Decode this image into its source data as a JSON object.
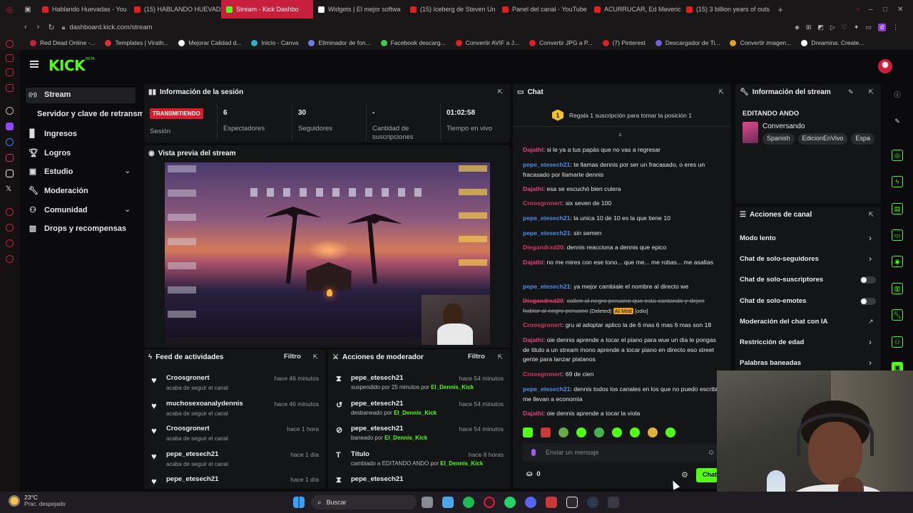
{
  "browser": {
    "tabs": [
      {
        "title": "Hablando Huevadas - You",
        "color": "#e02020"
      },
      {
        "title": "(15) HABLANDO HUEVADA",
        "color": "#e02020"
      },
      {
        "title": "Stream - Kick Dashbo",
        "color": "#53fc18"
      },
      {
        "title": "Widgets | El mejor softwa",
        "color": "#ffffff"
      },
      {
        "title": "(15) Iceberg de Steven Un",
        "color": "#e02020"
      },
      {
        "title": "Panel del canal - YouTube",
        "color": "#e02020"
      },
      {
        "title": "ACURRUCAR, Ed Maverick",
        "color": "#e02020"
      },
      {
        "title": "(15) 3 billion years of outs",
        "color": "#e02020"
      }
    ],
    "url": "dashboard.kick.com/stream",
    "bookmarks": [
      {
        "label": "Red Dead Online -...",
        "color": "#c81f3c"
      },
      {
        "label": "Templates | Virath...",
        "color": "#e03030"
      },
      {
        "label": "Mejorar Calidad d...",
        "color": "#ffffff"
      },
      {
        "label": "Inicio - Canva",
        "color": "#2bb0d0"
      },
      {
        "label": "Eliminador de fon...",
        "color": "#6a7ef0"
      },
      {
        "label": "Facebook descarg...",
        "color": "#3cd050"
      },
      {
        "label": "Convertir AVIF a J...",
        "color": "#e02020"
      },
      {
        "label": "Convertir JPG a P...",
        "color": "#e02020"
      },
      {
        "label": "(7) Pinterest",
        "color": "#e02020"
      },
      {
        "label": "Descargador de Ti...",
        "color": "#7060e0"
      },
      {
        "label": "Convertir imagen...",
        "color": "#e0a020"
      },
      {
        "label": "Dreamina: Create...",
        "color": "#ffffff"
      }
    ]
  },
  "kick": {
    "logo": "KICK",
    "logo_badge": "BETA",
    "sidebar": [
      {
        "label": "Stream",
        "icon": "broadcast-icon",
        "active": true
      },
      {
        "label": "Servidor y clave de retransm",
        "icon": "",
        "sub": true
      },
      {
        "label": "Ingresos",
        "icon": "chart-icon"
      },
      {
        "label": "Logros",
        "icon": "trophy-icon"
      },
      {
        "label": "Estudio",
        "icon": "studio-icon",
        "chevron": true
      },
      {
        "label": "Moderación",
        "icon": "wrench-icon"
      },
      {
        "label": "Comunidad",
        "icon": "community-icon",
        "chevron": true
      },
      {
        "label": "Drops y recompensas",
        "icon": "gift-icon"
      }
    ],
    "session": {
      "title": "Información de la sesión",
      "status_badge": "TRANSMITIENDO",
      "status_label": "Sesión",
      "stats": [
        {
          "value": "6",
          "label": "Espectadores"
        },
        {
          "value": "30",
          "label": "Seguidores"
        },
        {
          "value": "-",
          "label": "Cantidad de suscripciones"
        },
        {
          "value": "01:02:58",
          "label": "Tiempo en vivo"
        }
      ]
    },
    "preview": {
      "title": "Vista previa del stream"
    },
    "feed": {
      "title": "Feed de actividades",
      "filter": "Filtro",
      "items": [
        {
          "name": "Croosgronert",
          "sub": "acaba de seguir el canal",
          "time": "hace 46 minutos"
        },
        {
          "name": "muchosexoanalydennis",
          "sub": "acaba de seguir el canal",
          "time": "hace 46 minutos"
        },
        {
          "name": "Croosgronert",
          "sub": "acaba de seguir el canal",
          "time": "hace 1 hora"
        },
        {
          "name": "pepe_etesech21",
          "sub": "acaba de seguir el canal",
          "time": "hace 1 día"
        },
        {
          "name": "pepe_etesech21",
          "sub": "",
          "time": "hace 1 día"
        }
      ]
    },
    "mod": {
      "title": "Acciones de moderador",
      "filter": "Filtro",
      "items": [
        {
          "name": "pepe_etesech21",
          "sub": "suspendido por 25 minutos por",
          "by": "El_Dennis_Kick",
          "time": "hace 54 minutos",
          "icon": "hourglass-icon"
        },
        {
          "name": "pepe_etesech21",
          "sub": "desbaneado por",
          "by": "El_Dennis_Kick",
          "time": "hace 54 minutos",
          "icon": "undo-icon"
        },
        {
          "name": "pepe_etesech21",
          "sub": "baneado por",
          "by": "El_Dennis_Kick",
          "time": "hace 54 minutos",
          "icon": "ban-icon"
        },
        {
          "name": "Título",
          "sub": "cambiado a EDITANDO ANDO por",
          "by": "El_Dennis_Kick",
          "time": "hace 8 horas",
          "icon": "title-icon"
        },
        {
          "name": "pepe_etesech21",
          "sub": "",
          "by": "",
          "time": "",
          "icon": "hourglass-icon"
        }
      ]
    },
    "chat": {
      "title": "Chat",
      "sub_banner": "Regala 1 suscripción para tomar la posición 1",
      "input_placeholder": "Enviar un mensaje",
      "points": "0",
      "send": "Chat",
      "messages": [
        {
          "user": "Dajathi",
          "color": "pink",
          "text": "si le ya a tus papás que no vas a regresar"
        },
        {
          "user": "pepe_etesech21",
          "color": "blue",
          "text": "te llamas dennis por ser un fracasado, o eres un fracasado por llamarte dennis"
        },
        {
          "user": "Dajathi",
          "color": "pink",
          "text": "esa se escuchó bien culera"
        },
        {
          "user": "Croosgronert",
          "color": "red",
          "text": "six seven de 100"
        },
        {
          "user": "pepe_etesech21",
          "color": "blue",
          "text": "la unica 10 de 10 es la que tiene 10"
        },
        {
          "user": "pepe_etesech21",
          "color": "blue",
          "text": "sin semen"
        },
        {
          "user": "Diegandrxd20",
          "color": "red",
          "text": "dennis reacciona a dennis que epico"
        },
        {
          "user": "Dajathi",
          "color": "pink",
          "text": "no me mires con ese tono... que me... me robas... me asaltas"
        },
        {
          "user": "pepe_etesech21",
          "color": "blue",
          "text": "ya mejor cambiale el nombre al directo we"
        },
        {
          "user": "Diegandrxd20",
          "color": "red",
          "text": "callen al negro peruano que esta cantando y dejen hablar al negro peruano",
          "deleted": "(Deleted)",
          "ai": "AI Mod",
          "tag": "[odio]"
        },
        {
          "user": "Croosgronert",
          "color": "red",
          "text": "gru al adoptar aplico la de 6 mas 6 mas 6 mas son 18"
        },
        {
          "user": "Dajathi",
          "color": "pink",
          "text": "oie dennis aprende a tocar el piano para wue un dia le pongas de titulo a un stream mono aprende a tocar piano en directo eso street gente para lanzar platanos"
        },
        {
          "user": "Croosgronert",
          "color": "red",
          "text": "69 de cien"
        },
        {
          "user": "pepe_etesech21",
          "color": "blue",
          "text": "dennis todos los canales en los que no puedo escribir me llevan a economia"
        },
        {
          "user": "Dajathi",
          "color": "pink",
          "text": "oie dennis aprende a tocar la viola"
        }
      ]
    },
    "stream_info": {
      "title": "Información del stream",
      "stream_title": "EDITANDO ANDO",
      "category": "Conversando",
      "tags": [
        "Spanish",
        "EdicionEnVivo",
        "Espa"
      ]
    },
    "channel_actions": {
      "title": "Acciones de canal",
      "items": [
        {
          "label": "Modo lento",
          "type": "chevron"
        },
        {
          "label": "Chat de solo-seguidores",
          "type": "chevron"
        },
        {
          "label": "Chat de solo-suscriptores",
          "type": "toggle"
        },
        {
          "label": "Chat de solo-emotes",
          "type": "toggle"
        },
        {
          "label": "Moderación del chat con IA",
          "type": "external"
        },
        {
          "label": "Restricción de edad",
          "type": "chevron"
        },
        {
          "label": "Palabras baneadas",
          "type": "chevron"
        }
      ]
    }
  },
  "taskbar": {
    "weather_temp": "23°C",
    "weather_desc": "Prac. despejado",
    "search": "Buscar"
  },
  "colors": {
    "kick_green": "#53fc18",
    "live_red": "#d81c2c",
    "tab_red": "#c81f3c"
  }
}
